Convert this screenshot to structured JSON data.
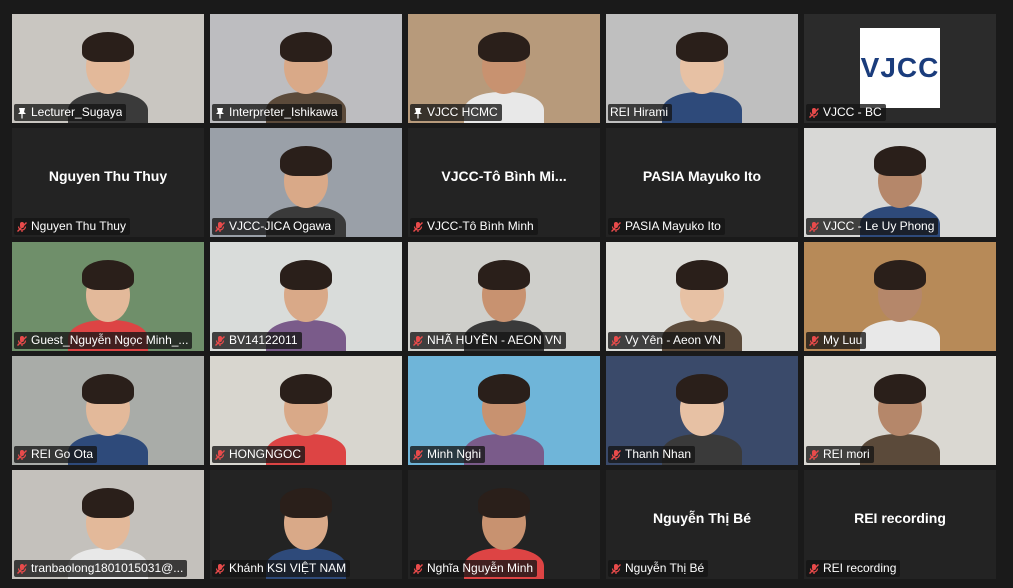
{
  "meeting": {
    "participants": [
      {
        "label": "Lecturer_Sugaya",
        "icon": "pin-icon",
        "video": true,
        "bg": "#c9c6c1"
      },
      {
        "label": "Interpreter_Ishikawa",
        "icon": "pin-icon",
        "video": true,
        "bg": "#bdbdc0"
      },
      {
        "label": "VJCC HCMC",
        "icon": "pin-icon",
        "video": true,
        "bg": "#b79a7b",
        "active": true
      },
      {
        "label": "REI Hirami",
        "icon": "",
        "video": true,
        "bg": "#bfbfbf"
      },
      {
        "label": "VJCC - BC",
        "icon": "mic-muted-icon",
        "video": true,
        "bg": "#2b2b2b",
        "logo": "VJCC"
      },
      {
        "label": "Nguyen Thu Thuy",
        "icon": "mic-muted-icon",
        "video": false,
        "display": "Nguyen Thu Thuy"
      },
      {
        "label": "VJCC-JICA Ogawa",
        "icon": "mic-muted-icon",
        "video": true,
        "bg": "#9aa0a8"
      },
      {
        "label": "VJCC-Tô Bình Minh",
        "icon": "mic-muted-icon",
        "video": false,
        "display": "VJCC-Tô Bình Mi..."
      },
      {
        "label": "PASIA Mayuko Ito",
        "icon": "mic-muted-icon",
        "video": false,
        "display": "PASIA Mayuko Ito"
      },
      {
        "label": "VJCC - Le Uy Phong",
        "icon": "mic-muted-icon",
        "video": true,
        "bg": "#d8d8d6"
      },
      {
        "label": "Guest_Nguyễn Ngọc Minh_...",
        "icon": "mic-muted-icon",
        "video": true,
        "bg": "#6f8f6a"
      },
      {
        "label": "BV14122011",
        "icon": "mic-muted-icon",
        "video": true,
        "bg": "#d9dcda"
      },
      {
        "label": "NHÃ HUYỀN - AEON VN",
        "icon": "mic-muted-icon",
        "video": true,
        "bg": "#cfcfcb"
      },
      {
        "label": "Vy Yên - Aeon VN",
        "icon": "mic-muted-icon",
        "video": true,
        "bg": "#dcdcd8"
      },
      {
        "label": "My Luu",
        "icon": "mic-muted-icon",
        "video": true,
        "bg": "#b78a58"
      },
      {
        "label": "REI Go Ota",
        "icon": "mic-muted-icon",
        "video": true,
        "bg": "#a9aca8"
      },
      {
        "label": "HONGNGOC",
        "icon": "mic-muted-icon",
        "video": true,
        "bg": "#d8d6cf"
      },
      {
        "label": "Minh Nghi",
        "icon": "mic-muted-icon",
        "video": true,
        "bg": "#6fb5d9"
      },
      {
        "label": "Thanh Nhan",
        "icon": "mic-muted-icon",
        "video": true,
        "bg": "#3a4a6a"
      },
      {
        "label": "REI mori",
        "icon": "mic-muted-icon",
        "video": true,
        "bg": "#dad8d2"
      },
      {
        "label": "tranbaolong1801015031@...",
        "icon": "mic-muted-icon",
        "video": true,
        "bg": "#c4c1bc"
      },
      {
        "label": "Khánh KSI VIỆT NAM",
        "icon": "mic-muted-icon",
        "video": true,
        "bg": "#232323"
      },
      {
        "label": "Nghĩa Nguyễn Minh",
        "icon": "mic-muted-icon",
        "video": true,
        "bg": "#232323"
      },
      {
        "label": "Nguyễn Thị Bé",
        "icon": "mic-muted-icon",
        "video": false,
        "display": "Nguyễn Thị Bé"
      },
      {
        "label": "REI recording",
        "icon": "mic-muted-icon",
        "video": false,
        "display": "REI recording"
      }
    ]
  }
}
